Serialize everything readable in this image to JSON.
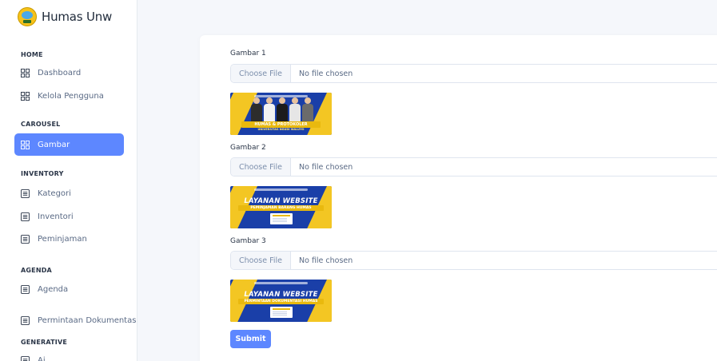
{
  "brand": {
    "name": "Humas Unw"
  },
  "sidebar": {
    "sections": [
      {
        "title": "HOME",
        "items": [
          {
            "label": "Dashboard",
            "icon": "grid-icon"
          },
          {
            "label": "Kelola Pengguna",
            "icon": "grid-icon"
          }
        ]
      },
      {
        "title": "CAROUSEL",
        "items": [
          {
            "label": "Gambar",
            "icon": "grid-icon",
            "active": true
          }
        ]
      },
      {
        "title": "INVENTORY",
        "items": [
          {
            "label": "Kategori",
            "icon": "list-icon"
          },
          {
            "label": "Inventori",
            "icon": "list-icon"
          },
          {
            "label": "Peminjaman",
            "icon": "list-icon"
          }
        ]
      },
      {
        "title": "AGENDA",
        "items": [
          {
            "label": "Agenda",
            "icon": "list-icon"
          },
          {
            "label": "Permintaan Dokumentasi",
            "icon": "list-icon"
          }
        ]
      },
      {
        "title": "GENERATIVE",
        "items": [
          {
            "label": "Ai",
            "icon": "list-icon"
          }
        ]
      }
    ]
  },
  "form": {
    "fields": [
      {
        "label": "Gambar 1",
        "button": "Choose File",
        "status": "No file chosen",
        "preview": {
          "title": "HUMAS & PROTOKOLER",
          "subtitle": "UNIVERSITAS NGUDI WALUYO"
        }
      },
      {
        "label": "Gambar 2",
        "button": "Choose File",
        "status": "No file chosen",
        "preview": {
          "title": "LAYANAN WEBSITE",
          "subtitle": "PEMINJAMAN BARANG HUMAS"
        }
      },
      {
        "label": "Gambar 3",
        "button": "Choose File",
        "status": "No file chosen",
        "preview": {
          "title": "LAYANAN WEBSITE",
          "subtitle": "PERMINTAAN DOKUMENTASI HUMAS"
        }
      }
    ],
    "submit_label": "Submit"
  },
  "colors": {
    "accent": "#5d87ff",
    "banner_blue": "#1a3fa8",
    "banner_yellow": "#f3c623"
  }
}
